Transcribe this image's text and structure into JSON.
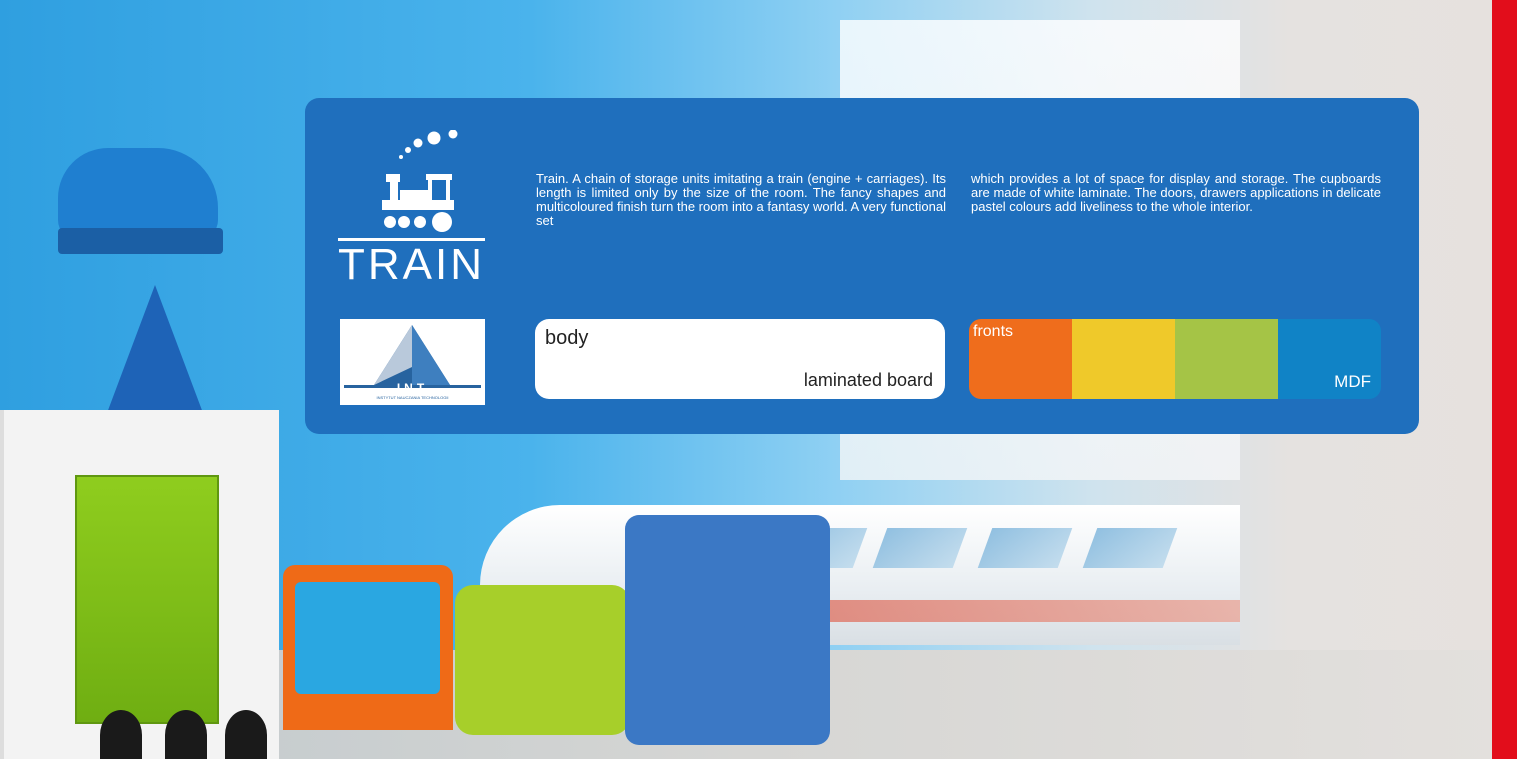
{
  "brand": {
    "title": "TRAIN",
    "int_logo_text": "INT",
    "int_logo_subtext": "INSTYTUT NAUCZANIA TECHNOLOGII"
  },
  "description": {
    "col1": "Train. A chain of storage units imitating a train (engine + carriages). Its length is limited only by the size of the room. The fancy shapes and multicoloured finish turn the room into a fantasy world. A very functional set",
    "col2": "which provides a lot of space for display and storage. The cupboards are made of white laminate. The doors, drawers applications in delicate pastel colours add liveliness to the whole interior."
  },
  "body": {
    "label": "body",
    "value": "laminated board"
  },
  "fronts": {
    "label": "fronts",
    "value": "MDF",
    "swatches": [
      "#ef6d1c",
      "#efc92a",
      "#a5c446",
      "#1083c6"
    ]
  },
  "colors": {
    "panel": "#1f6fbd",
    "accent_band": "#e20d1b"
  }
}
